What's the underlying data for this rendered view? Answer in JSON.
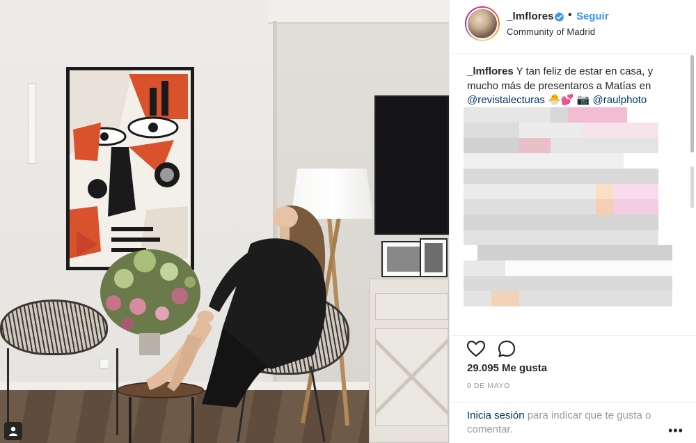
{
  "post": {
    "username": "_lmflores",
    "dot": "•",
    "follow_label": "Seguir",
    "location": "Community of Madrid",
    "caption": {
      "username": "_lmflores",
      "text": "Y tan feliz de estar en casa, y mucho más de presentaros a Matías en",
      "mention1": "@revistalecturas",
      "emojis1": "🐣💕",
      "emoji_camera": "📷",
      "mention2": "@raulphoto"
    },
    "likes": "29.095 Me gusta",
    "date": "9 DE MAYO",
    "login": {
      "link": "Inicia sesión",
      "text": "para indicar que te gusta o comentar."
    },
    "more_label": "•••"
  },
  "icons": {
    "like": "heart-outline-icon",
    "comment": "comment-bubble-icon",
    "verified": "verified-badge-icon",
    "profile": "user-profile-icon"
  },
  "colors": {
    "link_blue": "#3897f0",
    "mention_dark": "#003569",
    "text": "#262626",
    "muted": "#999999"
  }
}
